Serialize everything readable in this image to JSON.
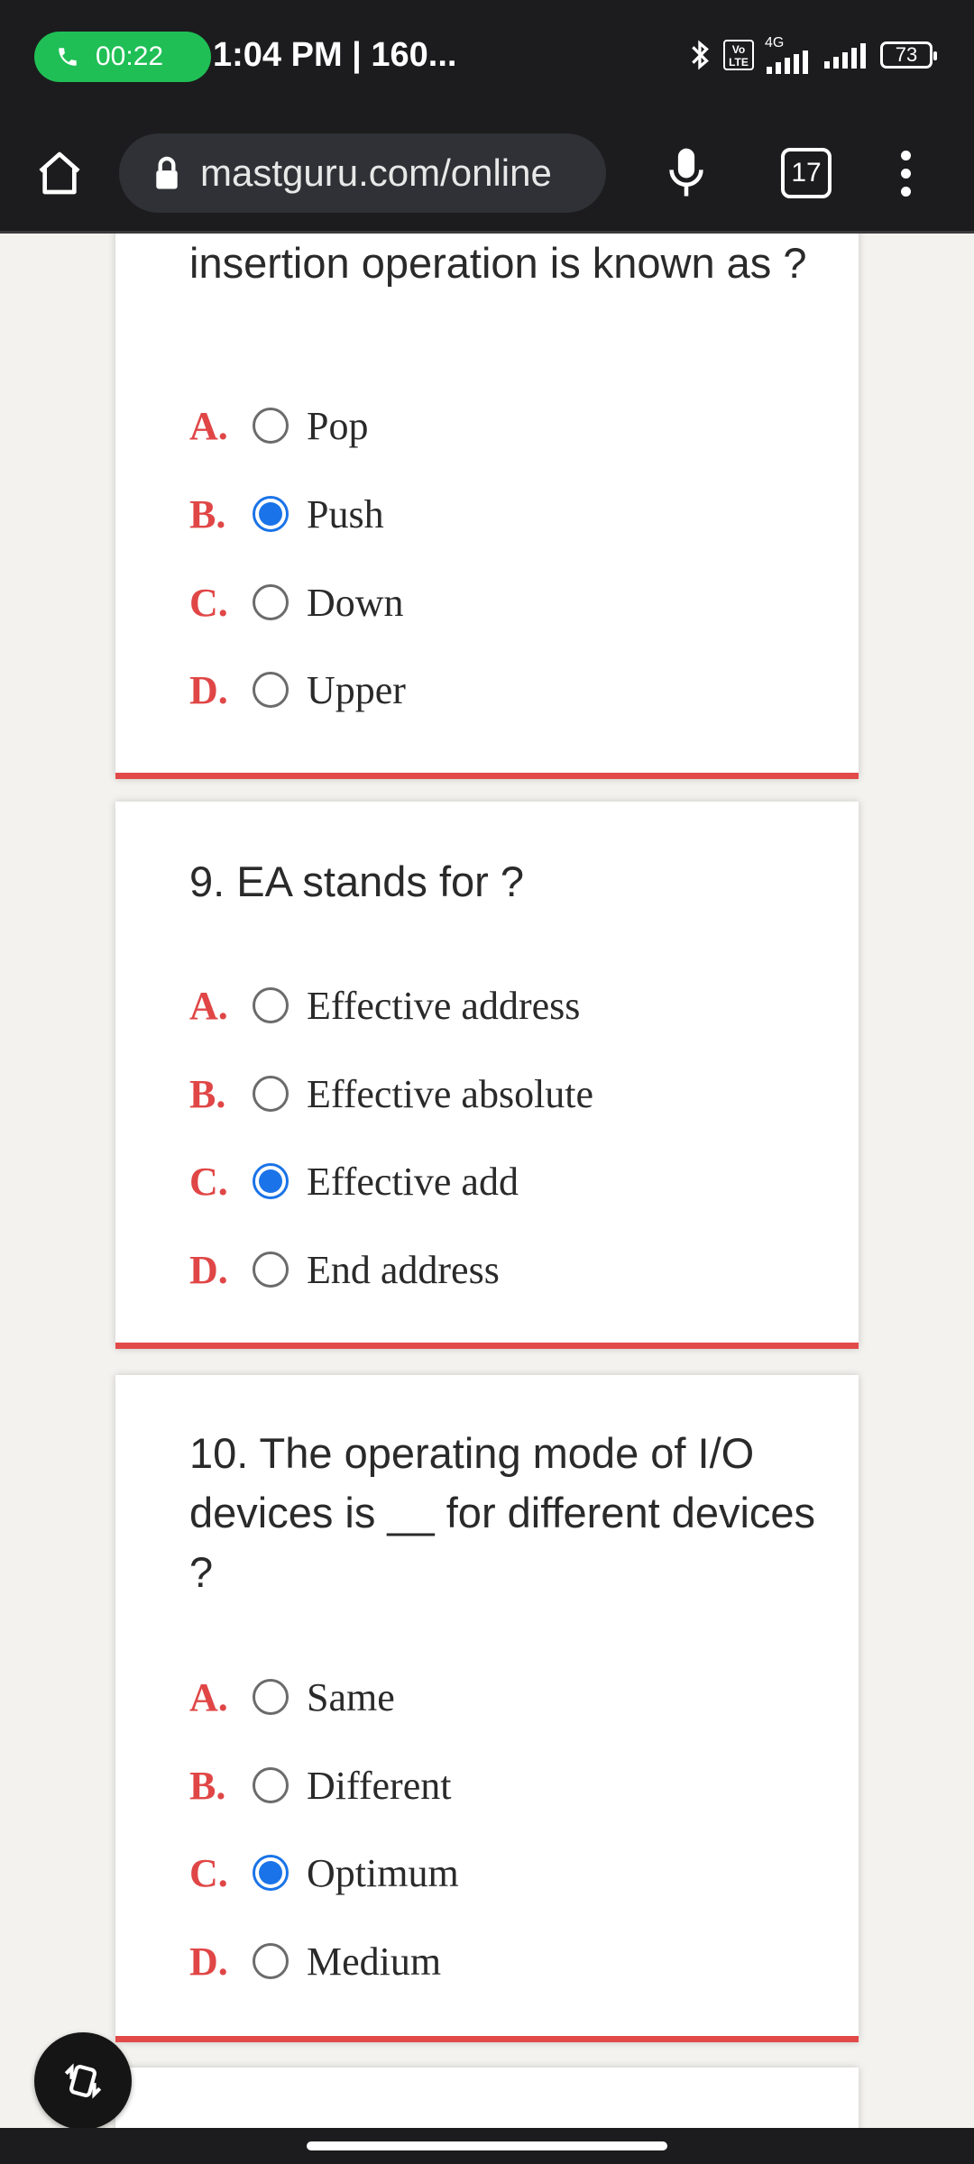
{
  "status_bar": {
    "call_time": "00:22",
    "time_text": "1:04 PM | 160...",
    "volte_label": "Vo\nLTE",
    "network_label": "4G",
    "battery_level": "73"
  },
  "browser": {
    "url": "mastguru.com/online",
    "tab_count": "17"
  },
  "quiz": {
    "q8": {
      "question_tail": "insertion operation is known as ?",
      "options": [
        {
          "letter": "A.",
          "label": "Pop",
          "selected": false
        },
        {
          "letter": "B.",
          "label": "Push",
          "selected": true
        },
        {
          "letter": "C.",
          "label": "Down",
          "selected": false
        },
        {
          "letter": "D.",
          "label": "Upper",
          "selected": false
        }
      ]
    },
    "q9": {
      "question": "9. EA stands for ?",
      "options": [
        {
          "letter": "A.",
          "label": "Effective address",
          "selected": false
        },
        {
          "letter": "B.",
          "label": "Effective absolute",
          "selected": false
        },
        {
          "letter": "C.",
          "label": "Effective add",
          "selected": true
        },
        {
          "letter": "D.",
          "label": "End address",
          "selected": false
        }
      ]
    },
    "q10": {
      "question": "10. The operating mode of I/O devices is __ for different devices ?",
      "options": [
        {
          "letter": "A.",
          "label": "Same",
          "selected": false
        },
        {
          "letter": "B.",
          "label": "Different",
          "selected": false
        },
        {
          "letter": "C.",
          "label": "Optimum",
          "selected": true
        },
        {
          "letter": "D.",
          "label": "Medium",
          "selected": false
        }
      ]
    }
  },
  "colors": {
    "accent_red": "#e24a4a",
    "radio_blue": "#1a73e8",
    "call_green": "#1fbf55"
  }
}
